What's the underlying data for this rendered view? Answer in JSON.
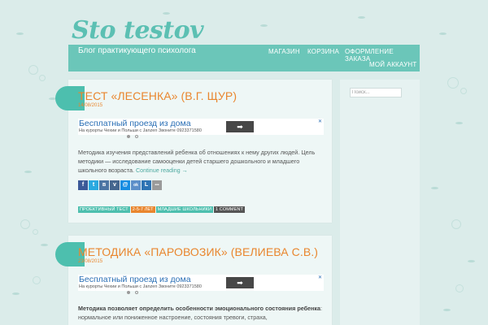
{
  "site": {
    "logo": "Sto testov",
    "tagline": "Блог практикующего психолога"
  },
  "nav": {
    "items": [
      {
        "label": "МАГАЗИН"
      },
      {
        "label": "КОРЗИНА"
      },
      {
        "label": "ОФОРМЛЕНИЕ ЗАКАЗА"
      },
      {
        "label": "МОЙ АККАУНТ"
      }
    ]
  },
  "posts": [
    {
      "title": "Тест «Лесенка» (В.Г. Щур)",
      "date": "14/08/2015",
      "ad": {
        "title": "Бесплатный проезд из дома",
        "sub": "На курорты Чехии и Польши с Janzen Звоните 0923371580",
        "button": "➡",
        "close": "✕"
      },
      "excerpt": "Методика изучения представлений ребенка об отношениях к нему других людей. Цель методики — исследование самооценки детей старшего дошкольного и младшего школьного возраста.",
      "more": "Continue reading →",
      "share": [
        {
          "glyph": "f",
          "icon": "facebook-icon",
          "color": "#3b5998"
        },
        {
          "glyph": "t",
          "icon": "twitter-icon",
          "color": "#2aa9e0"
        },
        {
          "glyph": "в",
          "icon": "vk-icon",
          "color": "#4c75a3"
        },
        {
          "glyph": "v",
          "icon": "vkontakte-icon",
          "color": "#45668e"
        },
        {
          "glyph": "@",
          "icon": "mail-icon",
          "color": "#168de2"
        },
        {
          "glyph": "ok",
          "icon": "odnoklassniki-icon",
          "color": "#5d8fc9"
        },
        {
          "glyph": "L",
          "icon": "livejournal-icon",
          "color": "#2d73b4"
        },
        {
          "glyph": "•••",
          "icon": "more-icon",
          "color": "#9a9a9a"
        }
      ],
      "tags": [
        {
          "label": "проективный тест",
          "color": "#4dbfae"
        },
        {
          "label": "2-5-7 лет",
          "color": "#e9862e"
        },
        {
          "label": "младшие школьники",
          "color": "#4dbfae"
        },
        {
          "label": "1 Comment",
          "color": "#555555"
        }
      ]
    },
    {
      "title": "Методика «Паровозик» (Велиева С.В.)",
      "date": "23/08/2015",
      "ad": {
        "title": "Бесплатный проезд из дома",
        "sub": "На курорты Чехии и Польши с Janzen Звоните 0923371580",
        "button": "➡",
        "close": "✕"
      },
      "excerpt_bold": "Методика позволяет определить особенности эмоционального состояния ребенка",
      "excerpt_rest": ": нормальное или пониженное настроение, состояния тревоги, страха,"
    }
  ],
  "sidebar": {
    "search_placeholder": "Поиск..."
  },
  "colors": {
    "background": "#dbecea",
    "header": "#6bc6b9",
    "accent_orange": "#e9862e",
    "accent_teal": "#4dbfae"
  }
}
